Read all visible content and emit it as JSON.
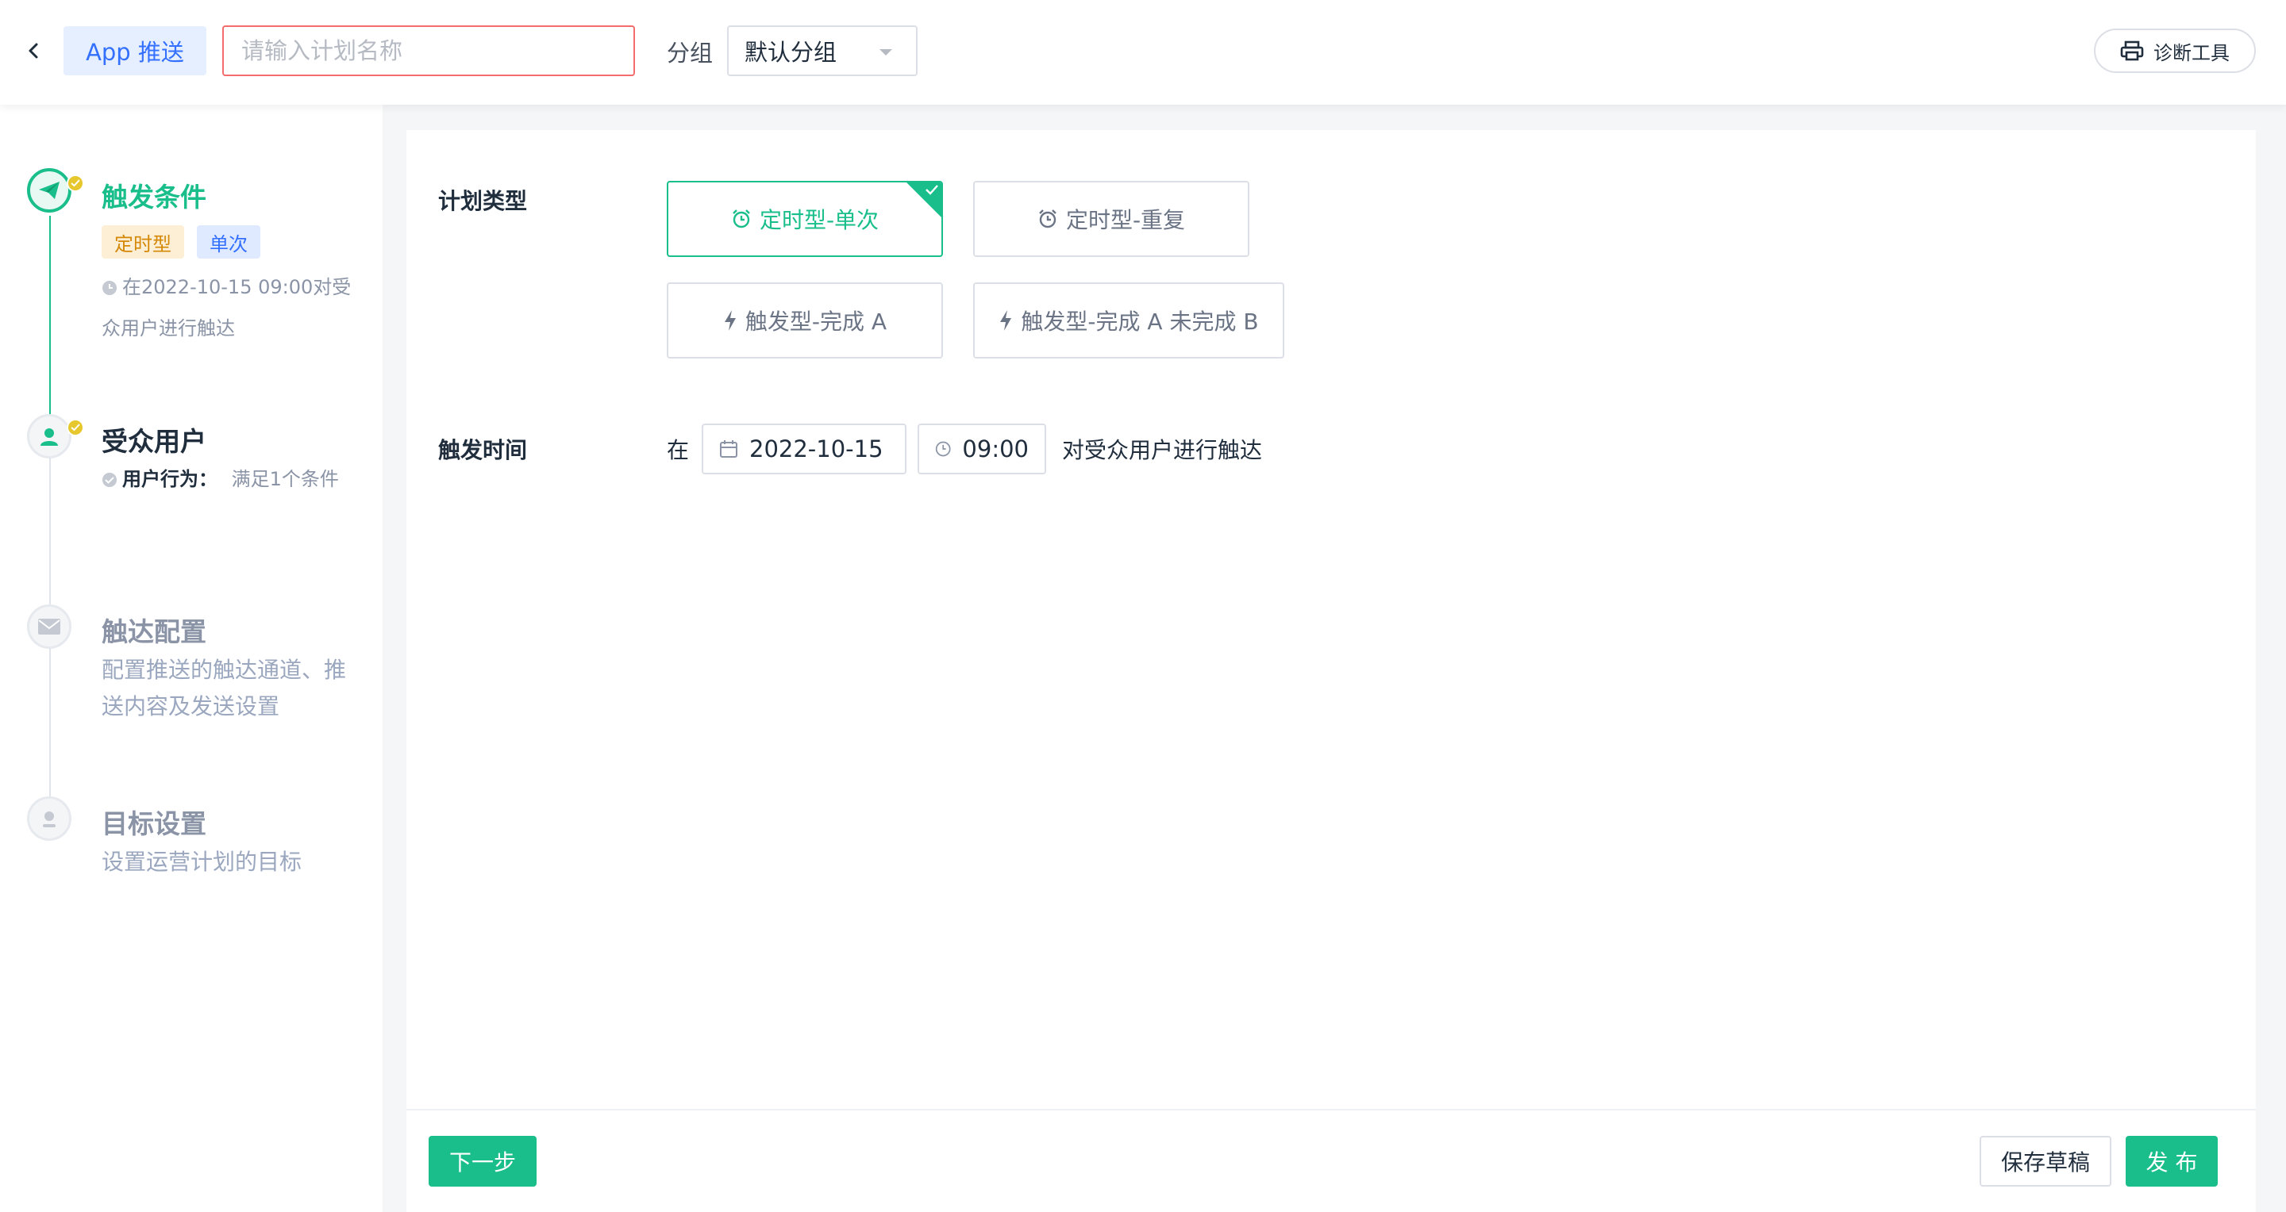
{
  "header": {
    "back_icon": "chevron-left-icon",
    "app_badge": "App 推送",
    "name_placeholder": "请输入计划名称",
    "name_value": "",
    "group_label": "分组",
    "group_value": "默认分组",
    "diag_icon": "printer-icon",
    "diag_label": "诊断工具"
  },
  "steps": [
    {
      "title": "触发条件",
      "status": "active",
      "icon": "paper-plane-icon",
      "tags": [
        "定时型",
        "单次"
      ],
      "desc_line1": "在2022-10-15 09:00对受",
      "desc_line2": "众用户进行触达"
    },
    {
      "title": "受众用户",
      "status": "done",
      "icon": "user-icon",
      "desc_label": "用户行为：",
      "desc_value": "满足1个条件"
    },
    {
      "title": "触达配置",
      "status": "pending",
      "icon": "envelope-icon",
      "desc_line1": "配置推送的触达通道、推",
      "desc_line2": "送内容及发送设置"
    },
    {
      "title": "目标设置",
      "status": "pending",
      "icon": "target-icon",
      "desc_line1": "设置运营计划的目标"
    }
  ],
  "main": {
    "plan_type_label": "计划类型",
    "plan_types": [
      {
        "label": "定时型-单次",
        "icon": "alarm-clock-icon",
        "selected": true
      },
      {
        "label": "定时型-重复",
        "icon": "alarm-clock-icon",
        "selected": false
      },
      {
        "label": "触发型-完成 A",
        "icon": "lightning-icon",
        "selected": false
      },
      {
        "label": "触发型-完成 A 未完成 B",
        "icon": "lightning-icon",
        "selected": false
      }
    ],
    "trigger_time_label": "触发时间",
    "time_prefix": "在",
    "date_value": "2022-10-15",
    "time_value": "09:00",
    "time_suffix": "对受众用户进行触达"
  },
  "footer": {
    "next_label": "下一步",
    "save_draft_label": "保存草稿",
    "publish_label": "发 布"
  },
  "colors": {
    "accent_green": "#19be8b",
    "brand_blue": "#3370ff",
    "error_red": "#f56c6c",
    "tag_orange": "#d48806"
  }
}
